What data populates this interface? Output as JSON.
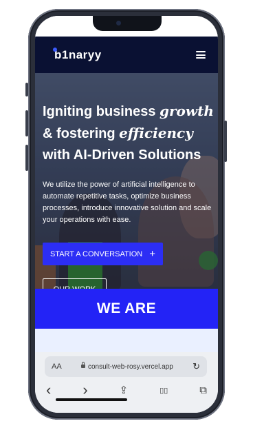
{
  "brand": {
    "logo_text": "b1naryy",
    "accent": "#2323f6",
    "nav_bg": "#0a1133"
  },
  "header": {
    "menu_icon": "hamburger-menu-icon"
  },
  "hero": {
    "headline_line1_prefix": "Igniting business ",
    "headline_line1_em": "growth",
    "headline_line2_prefix": "& fostering ",
    "headline_line2_em": "efficiency",
    "headline_line3": "with AI-Driven Solutions",
    "subtext": "We utilize the power of artificial intelligence to automate repetitive tasks, optimize business processes, introduce innovative solution and scale your operations with ease.",
    "cta_label": "START A CONVERSATION",
    "cta_icon": "+",
    "secondary_label": "OUR WORK"
  },
  "section": {
    "title": "WE ARE"
  },
  "browser": {
    "aa_label": "AA",
    "url": "consult-web-rosy.vercel.app",
    "back": "‹",
    "forward": "›",
    "share": "⇪",
    "bookmarks": "▯▯",
    "tabs": "⧉",
    "reload": "↻"
  }
}
